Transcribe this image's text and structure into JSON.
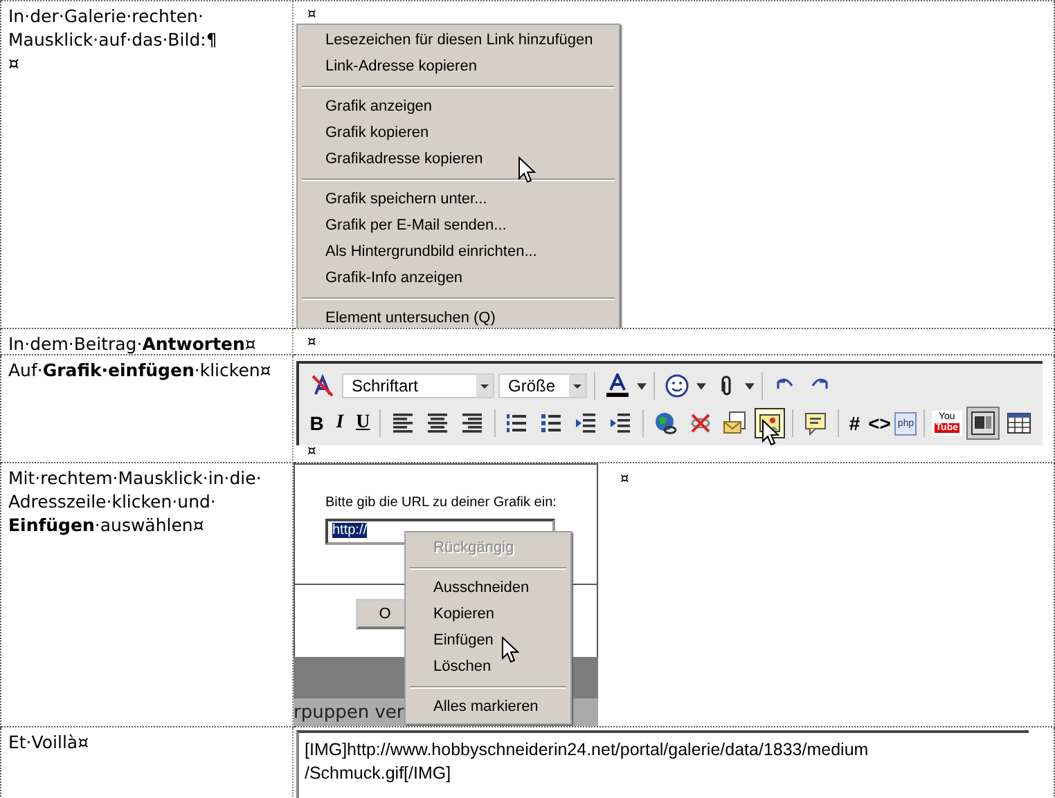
{
  "rows": [
    {
      "instruction": {
        "lines": [
          "In·der·Galerie·rechten·",
          "Mausklick·auf·das·Bild:¶",
          "¤"
        ]
      },
      "cell_mark": "¤",
      "menu": [
        {
          "kind": "item",
          "label": "Lesezeichen für diesen Link hinzufügen",
          "disabled": false
        },
        {
          "kind": "item",
          "label": "Link-Adresse kopieren",
          "disabled": false
        },
        {
          "kind": "separator"
        },
        {
          "kind": "item",
          "label": "Grafik anzeigen",
          "disabled": false
        },
        {
          "kind": "item",
          "label": "Grafik kopieren",
          "disabled": false
        },
        {
          "kind": "item",
          "label": "Grafikadresse kopieren",
          "disabled": false
        },
        {
          "kind": "separator"
        },
        {
          "kind": "item",
          "label": "Grafik speichern unter...",
          "disabled": false
        },
        {
          "kind": "item",
          "label": "Grafik per E-Mail senden...",
          "disabled": false
        },
        {
          "kind": "item",
          "label": "Als Hintergrundbild einrichten...",
          "disabled": false
        },
        {
          "kind": "item",
          "label": "Grafik-Info anzeigen",
          "disabled": false
        },
        {
          "kind": "separator"
        },
        {
          "kind": "item",
          "label": "Element untersuchen (Q)",
          "disabled": false
        }
      ]
    },
    {
      "instruction": {
        "lines": [
          "In·dem·Beitrag·**Antworten**¤"
        ]
      },
      "cell_mark": "¤"
    },
    {
      "instruction": {
        "lines": [
          "Auf·**Grafik·einfügen**·klicken¤"
        ]
      },
      "cell_mark": "¤",
      "toolbar": {
        "font_select": "Schriftart",
        "size_select": "Größe",
        "bold": "B",
        "italic": "I",
        "underline": "U",
        "hash": "#",
        "code": "<>",
        "php": "php",
        "youtube": [
          "You",
          "Tube"
        ]
      }
    },
    {
      "instruction": {
        "lines": [
          "Mit·rechtem·Mausklick·in·die·",
          "Adresszeile·klicken·und·",
          "**Einfügen**·auswählen¤"
        ]
      },
      "cell_mark": "¤",
      "dialog": {
        "prompt": "Bitte gib die URL zu deiner Grafik ein:",
        "value": "http://",
        "ok_button": "O",
        "background_text": "rpuppen ver"
      },
      "menu": [
        {
          "kind": "item",
          "label": "Rückgängig",
          "disabled": true
        },
        {
          "kind": "separator"
        },
        {
          "kind": "item",
          "label": "Ausschneiden",
          "disabled": false
        },
        {
          "kind": "item",
          "label": "Kopieren",
          "disabled": false
        },
        {
          "kind": "item",
          "label": "Einfügen",
          "disabled": false
        },
        {
          "kind": "item",
          "label": "Löschen",
          "disabled": false
        },
        {
          "kind": "separator"
        },
        {
          "kind": "item",
          "label": "Alles markieren",
          "disabled": false
        }
      ]
    },
    {
      "instruction": {
        "lines": [
          "Et·Voillà¤"
        ]
      },
      "result_text": [
        "[IMG]http://www.hobbyschneiderin24.net/portal/galerie/data/1833/medium",
        "/Schmuck.gif[/IMG]"
      ]
    }
  ]
}
